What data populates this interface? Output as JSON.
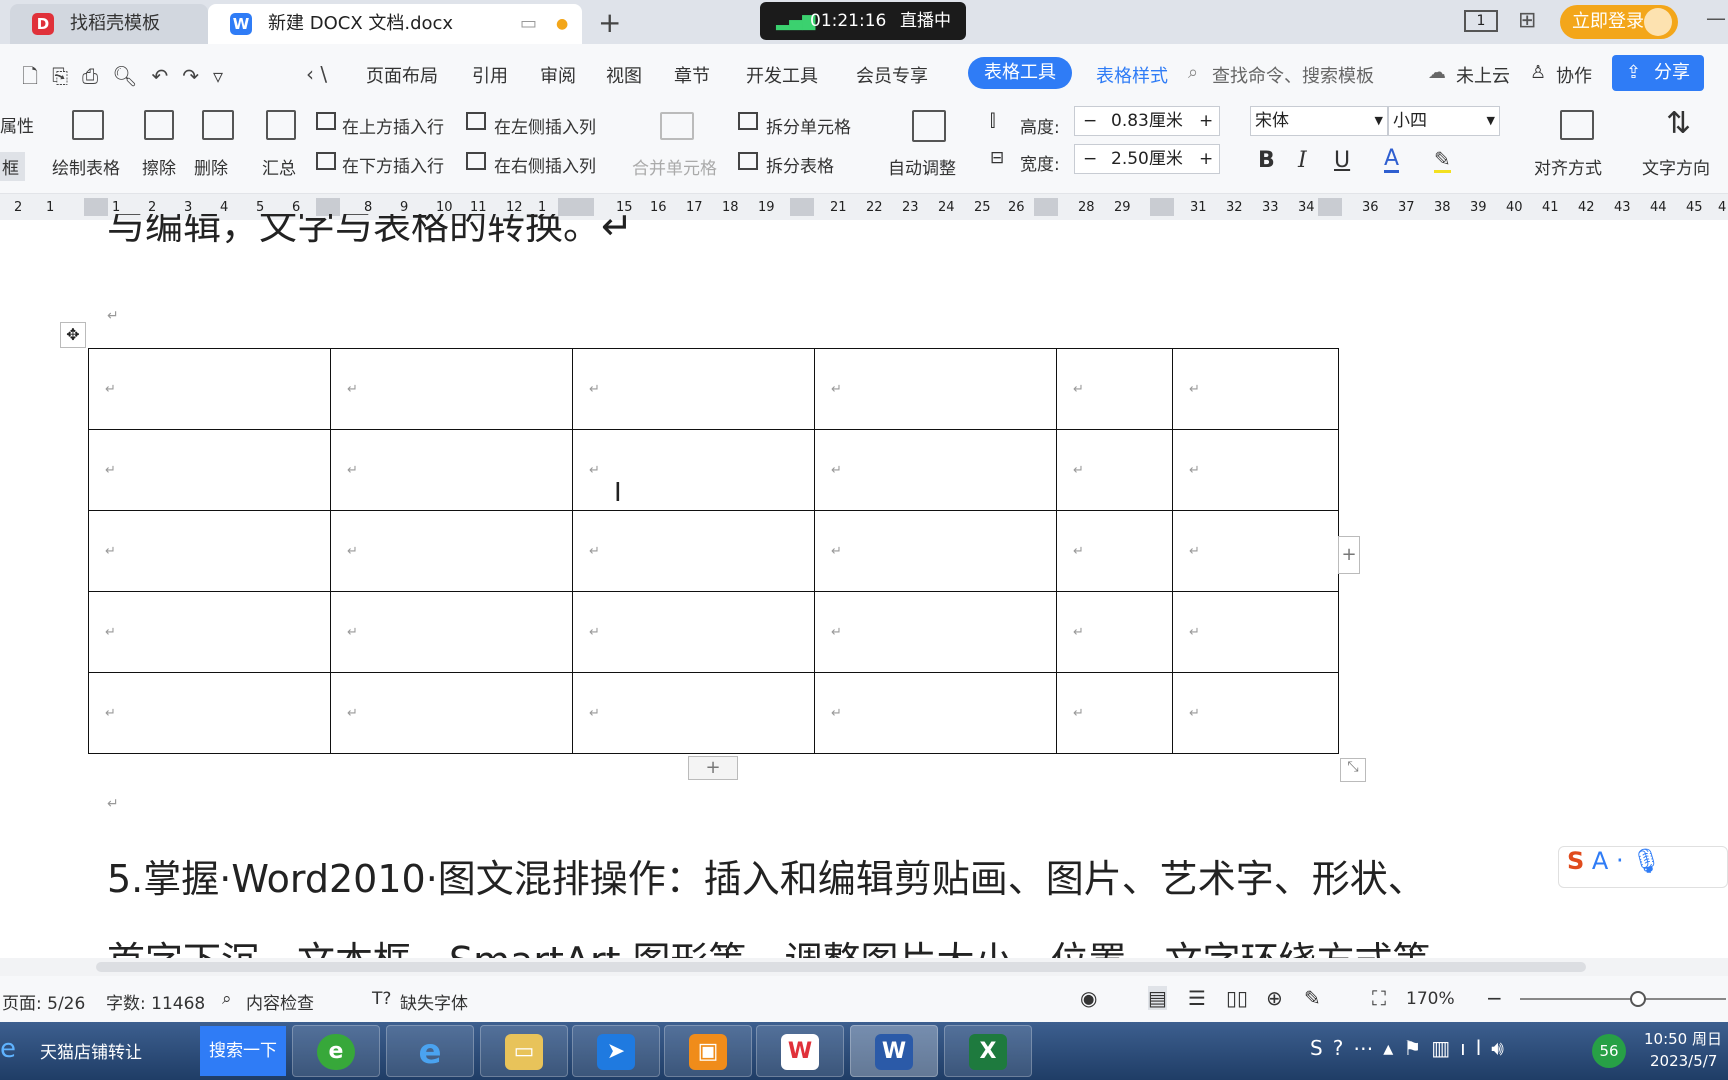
{
  "tabs": [
    {
      "label": "找稻壳模板"
    },
    {
      "label": "新建 DOCX 文档.docx"
    }
  ],
  "live": {
    "time": "01:21:16",
    "status": "直播中"
  },
  "title_right": {
    "login": "立即登录",
    "page_badge": "1"
  },
  "menu": {
    "items": [
      "页面布局",
      "引用",
      "审阅",
      "视图",
      "章节",
      "开发工具",
      "会员专享"
    ],
    "active": "表格工具",
    "table_style": "表格样式",
    "search_placeholder": "查找命令、搜索模板",
    "cloud": "未上云",
    "collab": "协作",
    "share": "分享"
  },
  "ribbon": {
    "left_cut": [
      "属性",
      "框"
    ],
    "draw": "绘制表格",
    "erase": "擦除",
    "delete": "删除",
    "summary": "汇总",
    "insert_above": "在上方插入行",
    "insert_below": "在下方插入行",
    "insert_left": "在左侧插入列",
    "insert_right": "在右侧插入列",
    "merge": "合并单元格",
    "split_cell": "拆分单元格",
    "split_table": "拆分表格",
    "autofit": "自动调整",
    "height_label": "高度:",
    "height_value": "0.83厘米",
    "width_label": "宽度:",
    "width_value": "2.50厘米",
    "font": "宋体",
    "size": "小四",
    "align": "对齐方式",
    "text_dir": "文字方向"
  },
  "ruler": {
    "ticks": [
      "2",
      "1",
      "1",
      "2",
      "3",
      "4",
      "5",
      "6",
      "8",
      "9",
      "10",
      "11",
      "12",
      "1",
      "15",
      "16",
      "17",
      "18",
      "19",
      "21",
      "22",
      "23",
      "24",
      "25",
      "26",
      "28",
      "29",
      "31",
      "32",
      "33",
      "34",
      "36",
      "37",
      "38",
      "39",
      "40",
      "41",
      "42",
      "43",
      "44",
      "45",
      "4"
    ]
  },
  "document": {
    "top_cut": "与编辑，文字与表格的转换。↵",
    "para_mark": "↵",
    "table": {
      "rows": 5,
      "cols": 6,
      "cell_mark": "↵"
    },
    "p5": "5.掌握·Word2010·图文混排操作：插入和编辑剪贴画、图片、艺术字、形状、",
    "p6": "首字下沉、文本框、SmartArt·图形等，调整图片大小、位置、文字环绕方式等"
  },
  "status": {
    "page": "页面: 5/26",
    "words": "字数: 11468",
    "check": "内容检查",
    "missing_font": "缺失字体",
    "zoom": "170%"
  },
  "taskbar": {
    "ie_label": "天猫店铺转让",
    "search": "搜索一下",
    "time": "10:50 周日",
    "date": "2023/5/7",
    "badge": "56"
  }
}
